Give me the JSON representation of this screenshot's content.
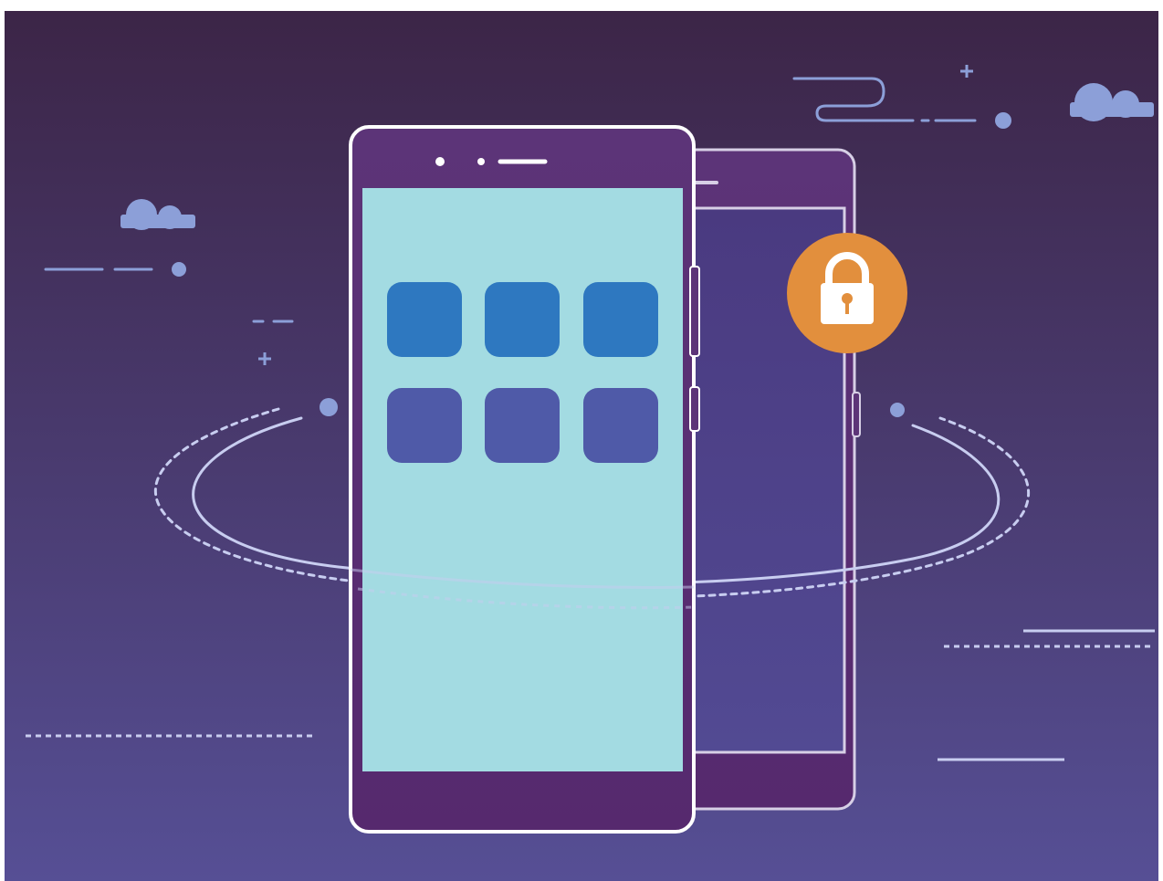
{
  "illustration": {
    "subject": "phone-clone-with-lock",
    "colors": {
      "background_top": "#3c2547",
      "background_bottom": "#564f95",
      "phone_frame": "#5a2f72",
      "phone_outline": "#ffffff",
      "screen": "#a3dbe2",
      "app_icon_top_row": "#2e78c0",
      "app_icon_bottom_row": "#4f5aa8",
      "back_phone_screen": "#4e3f88",
      "lock_badge": "#e28f3d",
      "lock_icon": "#ffffff",
      "decoration": "#8c9fd8",
      "orbit_line": "#c8cdf0"
    },
    "front_phone": {
      "icon_rows": 2,
      "icons_per_row": 3
    },
    "back_phone": {
      "locked": true
    },
    "icons": [
      "lock-icon",
      "cloud-icon",
      "plus-icon",
      "app-icon"
    ]
  }
}
